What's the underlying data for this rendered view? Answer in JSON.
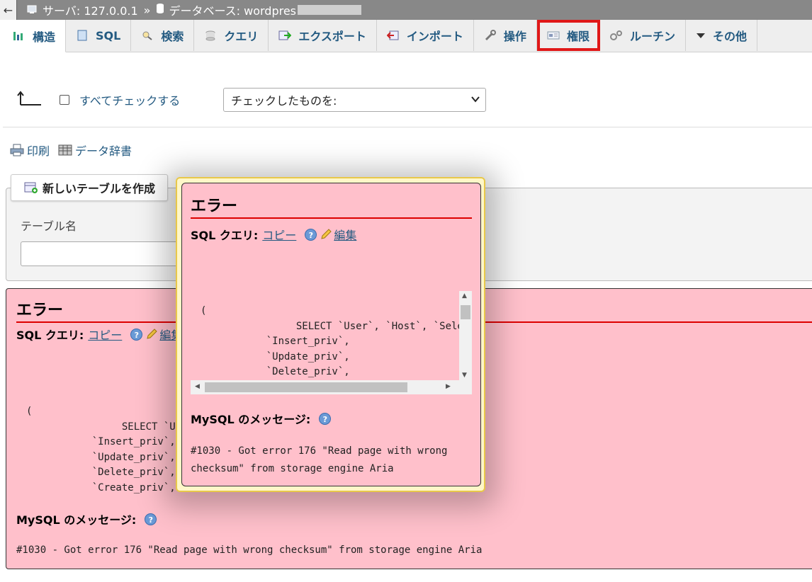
{
  "breadcrumb": {
    "back": "←",
    "server_label": "サーバ: 127.0.0.1",
    "separator": "»",
    "database_label": "データベース: wordpres"
  },
  "tabs": [
    {
      "label": "構造",
      "icon": "structure-icon",
      "active": true
    },
    {
      "label": "SQL",
      "icon": "sql-icon"
    },
    {
      "label": "検索",
      "icon": "search-icon"
    },
    {
      "label": "クエリ",
      "icon": "query-icon"
    },
    {
      "label": "エクスポート",
      "icon": "export-icon"
    },
    {
      "label": "インポート",
      "icon": "import-icon"
    },
    {
      "label": "操作",
      "icon": "wrench-icon"
    },
    {
      "label": "権限",
      "icon": "privileges-icon",
      "highlighted": true
    },
    {
      "label": "ルーチン",
      "icon": "routines-icon"
    },
    {
      "label": "その他",
      "icon": "caret-down-icon"
    }
  ],
  "check_all_label": "すべてチェックする",
  "with_selected_placeholder": "チェックしたものを:",
  "print_label": "印刷",
  "dictionary_label": "データ辞書",
  "create_table_button": "新しいテーブルを作成",
  "table_name_label": "テーブル名",
  "error": {
    "title": "エラー",
    "sql_query_label": "SQL クエリ:",
    "copy_link": "コピー",
    "edit_link": "編集",
    "help": "?",
    "code_main": "(\n                SELECT `User`,\n           `Insert_priv`,\n           `Update_priv`,\n           `Delete_priv`,\n           `Create_priv`,",
    "code_popup": "(\n                SELECT `User`, `Host`, `Select_priv\n           `Insert_priv`,\n           `Update_priv`,\n           `Delete_priv`,",
    "message_label": "MySQL のメッセージ:",
    "message_text": "#1030 - Got error 176 \"Read page with wrong checksum\" from storage engine Aria"
  },
  "colors": {
    "accent_link": "#235a81",
    "error_bg": "#ffc0cb",
    "highlight": "#e01818"
  }
}
